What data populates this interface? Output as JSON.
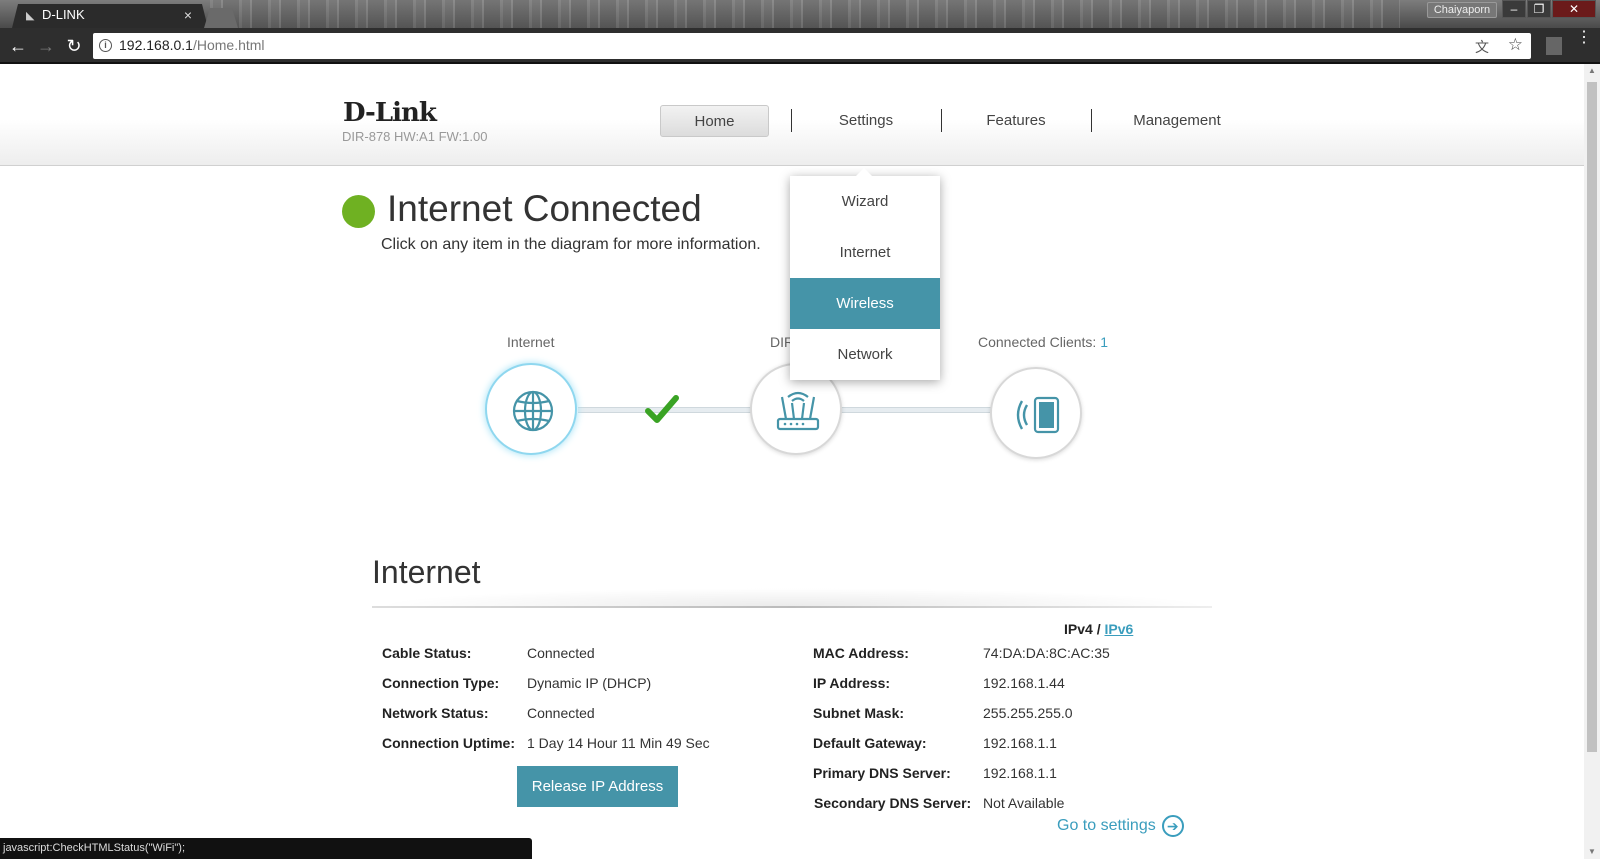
{
  "browser": {
    "tab_title": "D-LINK",
    "tab_close": "×",
    "user_name": "Chaiyaporn",
    "url_host": "192.168.0.1",
    "url_path": "/Home.html",
    "window_min": "–",
    "window_max": "❐",
    "window_close": "✕",
    "back": "←",
    "forward": "→",
    "reload": "↻",
    "info": "i",
    "translate": "⽂",
    "star": "☆",
    "menu": "⋮"
  },
  "header": {
    "logo": "D-Link",
    "model_info": "DIR-878 HW:A1 FW:1.00",
    "nav": [
      "Home",
      "Settings",
      "Features",
      "Management"
    ]
  },
  "dropdown": {
    "items": [
      "Wizard",
      "Internet",
      "Wireless",
      "Network"
    ],
    "selected": "Wireless"
  },
  "status": {
    "title": "Internet Connected",
    "subtitle": "Click on any item in the diagram for more information."
  },
  "diagram": {
    "internet_label": "Internet",
    "router_label": "DIR",
    "clients_label": "Connected Clients:",
    "clients_count": "1",
    "icons": [
      "globe-icon",
      "router-icon",
      "mobile-device-icon",
      "checkmark-icon"
    ],
    "colors": {
      "accent": "#4594a8",
      "ok": "#6fb122",
      "check": "#3aa324"
    }
  },
  "section": {
    "title": "Internet",
    "ipv4": "IPv4",
    "separator": "/",
    "ipv6": "IPv6"
  },
  "left_fields": [
    {
      "label": "Cable Status:",
      "value": "Connected"
    },
    {
      "label": "Connection Type:",
      "value": "Dynamic IP (DHCP)"
    },
    {
      "label": "Network Status:",
      "value": "Connected"
    },
    {
      "label": "Connection Uptime:",
      "value": "1 Day 14 Hour 11 Min 49 Sec"
    }
  ],
  "right_fields": [
    {
      "label": "MAC Address:",
      "value": "74:DA:DA:8C:AC:35"
    },
    {
      "label": "IP Address:",
      "value": "192.168.1.44"
    },
    {
      "label": "Subnet Mask:",
      "value": "255.255.255.0"
    },
    {
      "label": "Default Gateway:",
      "value": "192.168.1.1"
    },
    {
      "label": "Primary DNS Server:",
      "value": "192.168.1.1"
    },
    {
      "label": "Secondary DNS Server:",
      "value": "Not Available"
    }
  ],
  "actions": {
    "release": "Release IP Address",
    "goto_settings": "Go to settings",
    "goto_arrow": "➔"
  },
  "statusbar": "javascript:CheckHTMLStatus(\"WiFi\");"
}
